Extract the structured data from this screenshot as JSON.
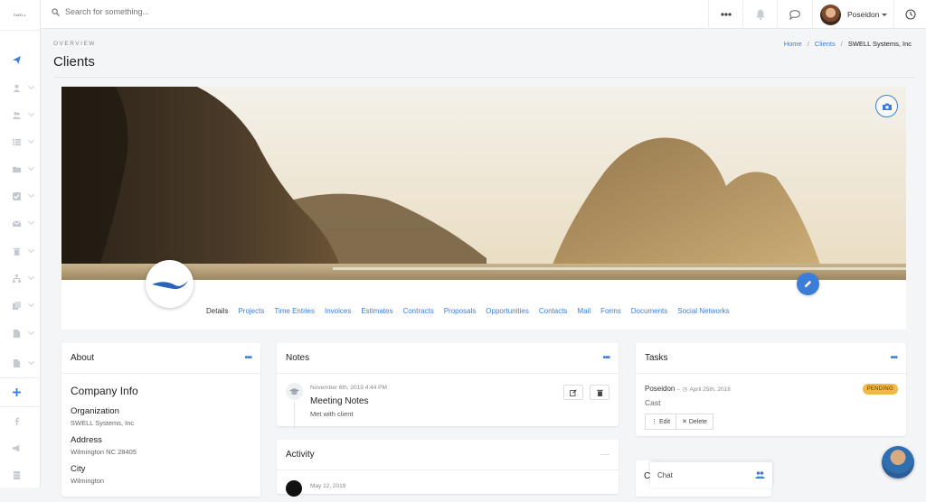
{
  "brand": {
    "logo_text": "SWELL"
  },
  "search": {
    "placeholder": "Search for something..."
  },
  "user": {
    "name": "Poseidon"
  },
  "page": {
    "overline": "OVERVIEW",
    "title": "Clients"
  },
  "breadcrumb": {
    "home": "Home",
    "clients": "Clients",
    "sep": "/",
    "current": "SWELL Systems, Inc"
  },
  "tabs": [
    "Details",
    "Projects",
    "Time Entries",
    "Invoices",
    "Estimates",
    "Contracts",
    "Proposals",
    "Opportunities",
    "Contacts",
    "Mail",
    "Forms",
    "Documents",
    "Social Networks"
  ],
  "about": {
    "title": "About",
    "section": "Company Info",
    "fields": [
      {
        "label": "Organization",
        "value": "SWELL Systems, Inc"
      },
      {
        "label": "Address",
        "value": "Wilmington NC 28405"
      },
      {
        "label": "City",
        "value": "Wilmington"
      }
    ]
  },
  "notes": {
    "title": "Notes",
    "items": [
      {
        "date": "November 6th, 2019 4:44 PM",
        "title": "Meeting Notes",
        "body": "Met with client"
      }
    ]
  },
  "activity": {
    "title": "Activity",
    "first_date": "May 12, 2019"
  },
  "tasks": {
    "title": "Tasks",
    "items": [
      {
        "user": "Poseidon",
        "dash": "–",
        "date": "April 25th, 2018",
        "badge": "PENDING",
        "text": "Cast",
        "edit": "Edit",
        "delete": "Delete"
      }
    ]
  },
  "chat": {
    "label": "Chat"
  },
  "colors": {
    "accent": "#3b7dd8",
    "badge": "#f0b84a",
    "sidebar_icon": "#c4c9cf",
    "sidebar_active": "#3b7dd8"
  },
  "icons": [
    "paper-plane-icon",
    "user-icon",
    "users-icon",
    "list-icon",
    "folder-icon",
    "check-icon",
    "envelope-icon",
    "trash-icon",
    "sitemap-icon",
    "copy-icon",
    "file-icon",
    "file-icon",
    "plus-icon",
    "facebook-icon",
    "megaphone-icon",
    "database-icon",
    "ellipsis-icon",
    "bell-icon",
    "chat-bubble-icon",
    "clock-icon",
    "camera-icon",
    "pencil-icon"
  ]
}
